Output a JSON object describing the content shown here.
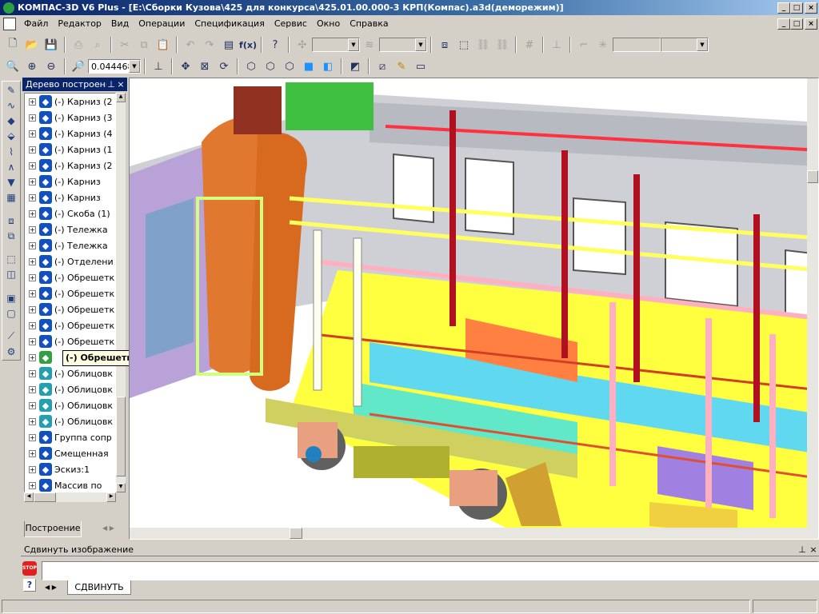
{
  "window": {
    "title": "КОМПАС-3D V6 Plus - [E:\\Сборки Кузова\\425 для конкурса\\425.01.00.000-3 КРП(Компас).a3d(деморежим)]",
    "min": "_",
    "max": "□",
    "close": "×"
  },
  "menu": [
    "Файл",
    "Редактор",
    "Вид",
    "Операции",
    "Спецификация",
    "Сервис",
    "Окно",
    "Справка"
  ],
  "view_toolbar": {
    "zoom_value": "0.044468"
  },
  "tree": {
    "title": "Дерево построени",
    "items": [
      "(-) Карниз (2",
      "(-) Карниз (3",
      "(-) Карниз (4",
      "(-) Карниз (1",
      "(-) Карниз (2",
      "(-) Карниз",
      "(-) Карниз",
      "(-) Скоба (1)",
      "(-) Тележка",
      "(-) Тележка",
      "(-) Отделени",
      "(-) Обрешетк",
      "(-) Обрешетк",
      "(-) Обрешетк",
      "(-) Обрешетк",
      "(-) Обрешетк",
      "",
      "(-) Облицовк",
      "(-) Облицовк",
      "(-) Облицовк",
      "(-) Облицовк",
      "Группа сопр",
      "Смещенная",
      "Эскиз:1",
      "Массив по"
    ],
    "tab": "Построение",
    "tooltip": "(-) Обрешетка продольных стен"
  },
  "command": {
    "title": "Сдвинуть изображение",
    "tab": "СДВИНУТЬ",
    "stop": "STOP",
    "help": "?"
  }
}
